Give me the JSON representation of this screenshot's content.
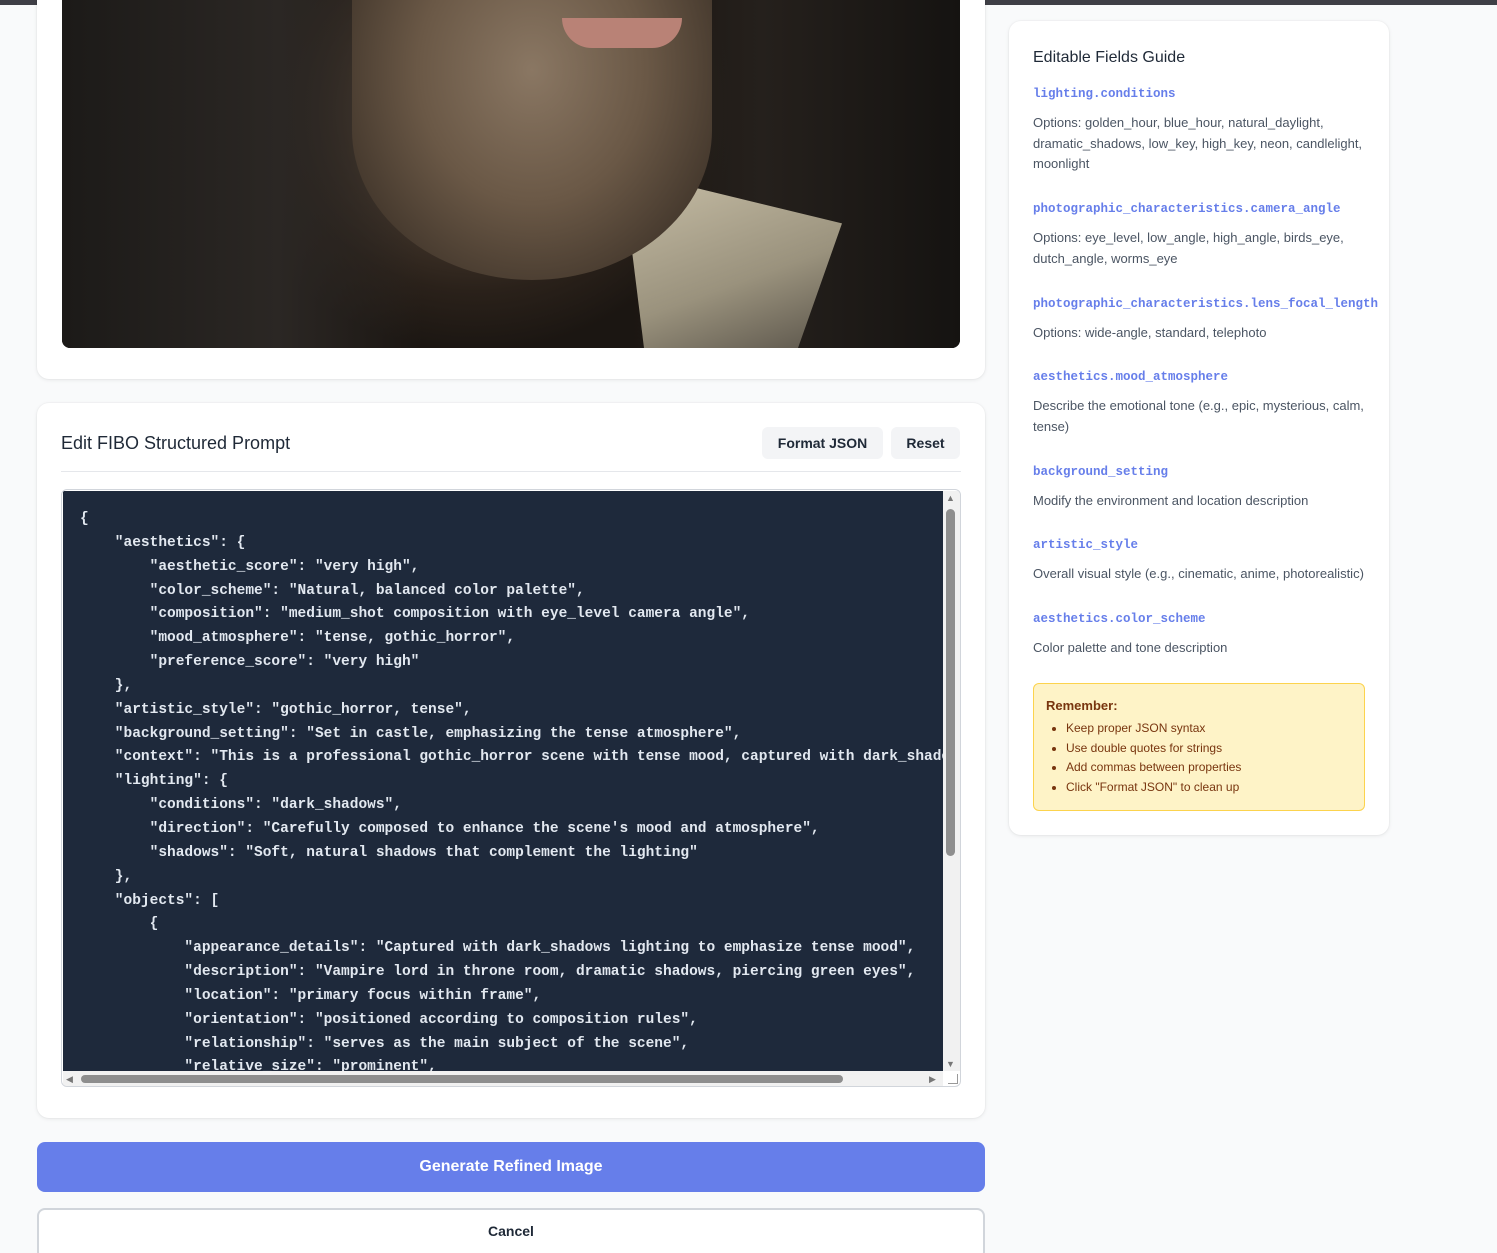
{
  "editor": {
    "title": "Edit FIBO Structured Prompt",
    "format_label": "Format JSON",
    "reset_label": "Reset",
    "json_text": "{\n    \"aesthetics\": {\n        \"aesthetic_score\": \"very high\",\n        \"color_scheme\": \"Natural, balanced color palette\",\n        \"composition\": \"medium_shot composition with eye_level camera angle\",\n        \"mood_atmosphere\": \"tense, gothic_horror\",\n        \"preference_score\": \"very high\"\n    },\n    \"artistic_style\": \"gothic_horror, tense\",\n    \"background_setting\": \"Set in castle, emphasizing the tense atmosphere\",\n    \"context\": \"This is a professional gothic_horror scene with tense mood, captured with dark_shadows\n    \"lighting\": {\n        \"conditions\": \"dark_shadows\",\n        \"direction\": \"Carefully composed to enhance the scene's mood and atmosphere\",\n        \"shadows\": \"Soft, natural shadows that complement the lighting\"\n    },\n    \"objects\": [\n        {\n            \"appearance_details\": \"Captured with dark_shadows lighting to emphasize tense mood\",\n            \"description\": \"Vampire lord in throne room, dramatic shadows, piercing green eyes\",\n            \"location\": \"primary focus within frame\",\n            \"orientation\": \"positioned according to composition rules\",\n            \"relationship\": \"serves as the main subject of the scene\",\n            \"relative_size\": \"prominent\","
  },
  "actions": {
    "generate_label": "Generate Refined Image",
    "cancel_label": "Cancel"
  },
  "guide": {
    "title": "Editable Fields Guide",
    "fields": [
      {
        "key": "lighting.conditions",
        "desc": "Options: golden_hour, blue_hour, natural_daylight, dramatic_shadows, low_key, high_key, neon, candlelight, moonlight"
      },
      {
        "key": "photographic_characteristics.camera_angle",
        "desc": "Options: eye_level, low_angle, high_angle, birds_eye, dutch_angle, worms_eye"
      },
      {
        "key": "photographic_characteristics.lens_focal_length",
        "desc": "Options: wide-angle, standard, telephoto"
      },
      {
        "key": "aesthetics.mood_atmosphere",
        "desc": "Describe the emotional tone (e.g., epic, mysterious, calm, tense)"
      },
      {
        "key": "background_setting",
        "desc": "Modify the environment and location description"
      },
      {
        "key": "artistic_style",
        "desc": "Overall visual style (e.g., cinematic, anime, photorealistic)"
      },
      {
        "key": "aesthetics.color_scheme",
        "desc": "Color palette and tone description"
      }
    ],
    "remember": {
      "title": "Remember:",
      "items": [
        "Keep proper JSON syntax",
        "Use double quotes for strings",
        "Add commas between properties",
        "Click \"Format JSON\" to clean up"
      ]
    }
  },
  "colors": {
    "accent": "#667eea",
    "code_bg": "#1e293b",
    "note_bg": "#fef3c7"
  },
  "icons": {
    "scroll_up": "triangle-up-icon",
    "scroll_down": "triangle-down-icon",
    "scroll_left": "triangle-left-icon",
    "scroll_right": "triangle-right-icon",
    "resize": "resize-handle-icon"
  }
}
